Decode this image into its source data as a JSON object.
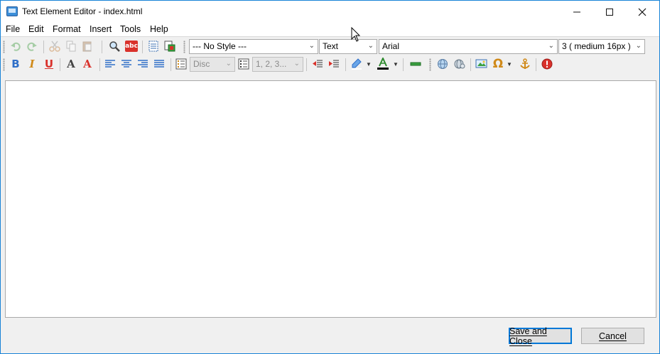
{
  "window": {
    "title": "Text Element Editor - index.html",
    "controls": {
      "minimize": "—",
      "maximize": "☐",
      "close": "✕"
    }
  },
  "menu": {
    "items": [
      "File",
      "Edit",
      "Format",
      "Insert",
      "Tools",
      "Help"
    ]
  },
  "toolbar": {
    "style_select": {
      "value": "--- No Style ---"
    },
    "element_select": {
      "value": "Text"
    },
    "font_select": {
      "value": "Arial"
    },
    "size_select": {
      "value": "3 ( medium 16px )"
    },
    "bullet_list_select": {
      "value": "Disc"
    },
    "numbered_list_select": {
      "value": "1, 2, 3..."
    },
    "spellcheck_label": "abc",
    "bold_label": "B",
    "italic_label": "I",
    "underline_label": "U",
    "font_label": "A",
    "omega_label": "Ω"
  },
  "colors": {
    "accent": "#0078d7",
    "border": "#1883d7",
    "font_color_bar": "#000000",
    "highlight_color_bar": "#ffffff"
  },
  "footer": {
    "save_close": "Save and Close",
    "cancel": "Cancel"
  }
}
